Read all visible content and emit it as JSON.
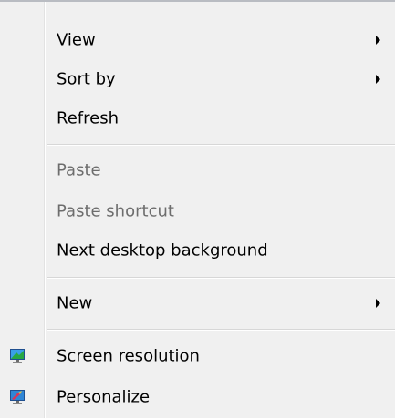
{
  "menu": {
    "items": [
      {
        "label": "View",
        "submenu": true,
        "enabled": true
      },
      {
        "label": "Sort by",
        "submenu": true,
        "enabled": true
      },
      {
        "label": "Refresh",
        "submenu": false,
        "enabled": true
      },
      {
        "label": "Paste",
        "submenu": false,
        "enabled": false
      },
      {
        "label": "Paste shortcut",
        "submenu": false,
        "enabled": false
      },
      {
        "label": "Next desktop background",
        "submenu": false,
        "enabled": true
      },
      {
        "label": "New",
        "submenu": true,
        "enabled": true
      },
      {
        "label": "Screen resolution",
        "submenu": false,
        "enabled": true,
        "icon": "monitor-icon"
      },
      {
        "label": "Personalize",
        "submenu": false,
        "enabled": true,
        "icon": "personalize-icon"
      }
    ],
    "colors": {
      "background": "#f0f0f0",
      "disabled_text": "#6d6d6d",
      "separator": "#d7d7d7"
    }
  }
}
